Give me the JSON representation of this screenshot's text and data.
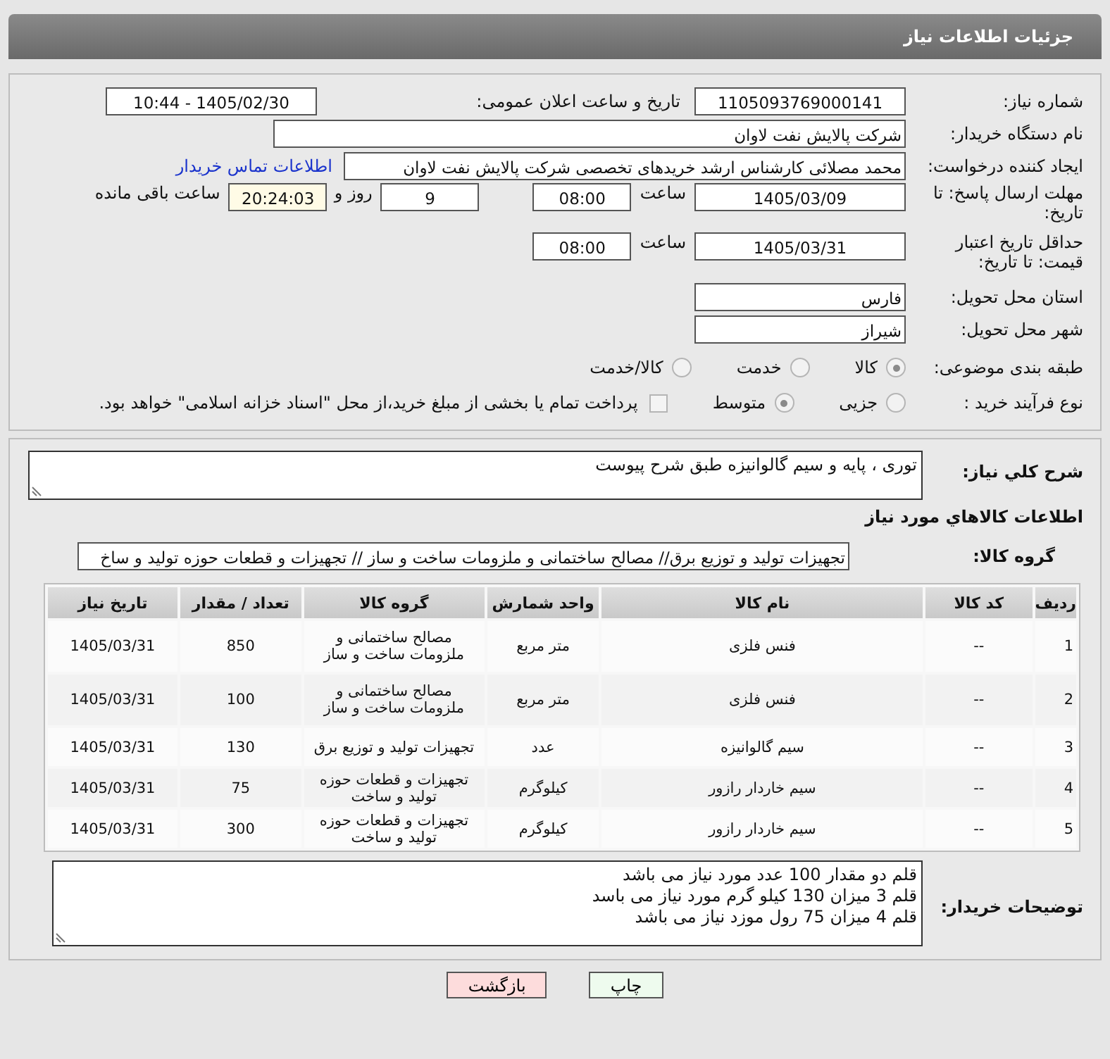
{
  "header": {
    "title": "جزئیات اطلاعات نیاز"
  },
  "need_number": {
    "label": "شماره نیاز:",
    "value": "1105093769000141"
  },
  "announce": {
    "label": "تاریخ و ساعت اعلان عمومی:",
    "value": "1405/02/30 - 10:44"
  },
  "buyer_org": {
    "label": "نام دستگاه خریدار:",
    "value": "شرکت پالایش نفت لاوان"
  },
  "requester": {
    "label": "ایجاد کننده درخواست:",
    "value": "محمد مصلائی کارشناس ارشد خریدهای تخصصی شرکت پالایش نفت لاوان",
    "link": "اطلاعات تماس خریدار"
  },
  "deadline": {
    "label": "مهلت ارسال پاسخ: تا تاریخ:",
    "date": "1405/03/09",
    "time_label": "ساعت",
    "time": "08:00",
    "days": "9",
    "days_label": "روز و",
    "remaining": "20:24:03",
    "remaining_label": "ساعت باقی مانده"
  },
  "validity": {
    "label": "حداقل تاریخ اعتبار قیمت: تا تاریخ:",
    "date": "1405/03/31",
    "time_label": "ساعت",
    "time": "08:00"
  },
  "province": {
    "label": "استان محل تحویل:",
    "value": "فارس"
  },
  "city": {
    "label": "شهر محل تحویل:",
    "value": "شیراز"
  },
  "category": {
    "label": "طبقه بندی موضوعی:",
    "options": [
      {
        "label": "کالا",
        "selected": true
      },
      {
        "label": "خدمت",
        "selected": false
      },
      {
        "label": "کالا/خدمت",
        "selected": false
      }
    ]
  },
  "process": {
    "label": "نوع فرآیند خرید :",
    "options": [
      {
        "label": "جزیی",
        "selected": false
      },
      {
        "label": "متوسط",
        "selected": true
      }
    ],
    "payment": {
      "label": "پرداخت تمام یا بخشی از مبلغ خرید،از محل \"اسناد خزانه اسلامی\" خواهد بود.",
      "checked": false
    }
  },
  "description": {
    "label": "شرح کلي نياز:",
    "value": "توری ، پایه و سیم گالوانیزه طبق شرح پیوست"
  },
  "goods_title": "اطلاعات کالاهاي مورد نياز",
  "goods_group": {
    "label": "گروه کالا:",
    "value": "تجهیزات تولید و توزیع برق// مصالح ساختمانی و ملزومات ساخت و ساز // تجهیزات و قطعات حوزه تولید و ساخ"
  },
  "table": {
    "columns": [
      "ردیف",
      "کد کالا",
      "نام کالا",
      "واحد شمارش",
      "گروه کالا",
      "تعداد / مقدار",
      "تاریخ نیاز"
    ],
    "rows": [
      [
        "1",
        "--",
        "فنس فلزی",
        "متر مربع",
        "مصالح ساختمانی و ملزومات ساخت و ساز",
        "850",
        "1405/03/31"
      ],
      [
        "2",
        "--",
        "فنس فلزی",
        "متر مربع",
        "مصالح ساختمانی و ملزومات ساخت و ساز",
        "100",
        "1405/03/31"
      ],
      [
        "3",
        "--",
        "سیم گالوانیزه",
        "عدد",
        "تجهیزات تولید و توزیع برق",
        "130",
        "1405/03/31"
      ],
      [
        "4",
        "--",
        "سیم خاردار رازور",
        "کیلوگرم",
        "تجهیزات و قطعات حوزه تولید و ساخت",
        "75",
        "1405/03/31"
      ],
      [
        "5",
        "--",
        "سیم خاردار رازور",
        "کیلوگرم",
        "تجهیزات و قطعات حوزه تولید و ساخت",
        "300",
        "1405/03/31"
      ]
    ]
  },
  "buyer_notes": {
    "label": "توضیحات خریدار:",
    "lines": [
      "قلم دو مقدار 100 عدد مورد نیاز می باشد",
      "قلم 3 میزان 130 کیلو گرم مورد نیاز می باسد",
      "قلم 4 میزان 75 رول موزد نیاز می باشد"
    ]
  },
  "buttons": [
    {
      "kind": "print",
      "label": "چاپ"
    },
    {
      "kind": "back",
      "label": "بازگشت"
    }
  ]
}
